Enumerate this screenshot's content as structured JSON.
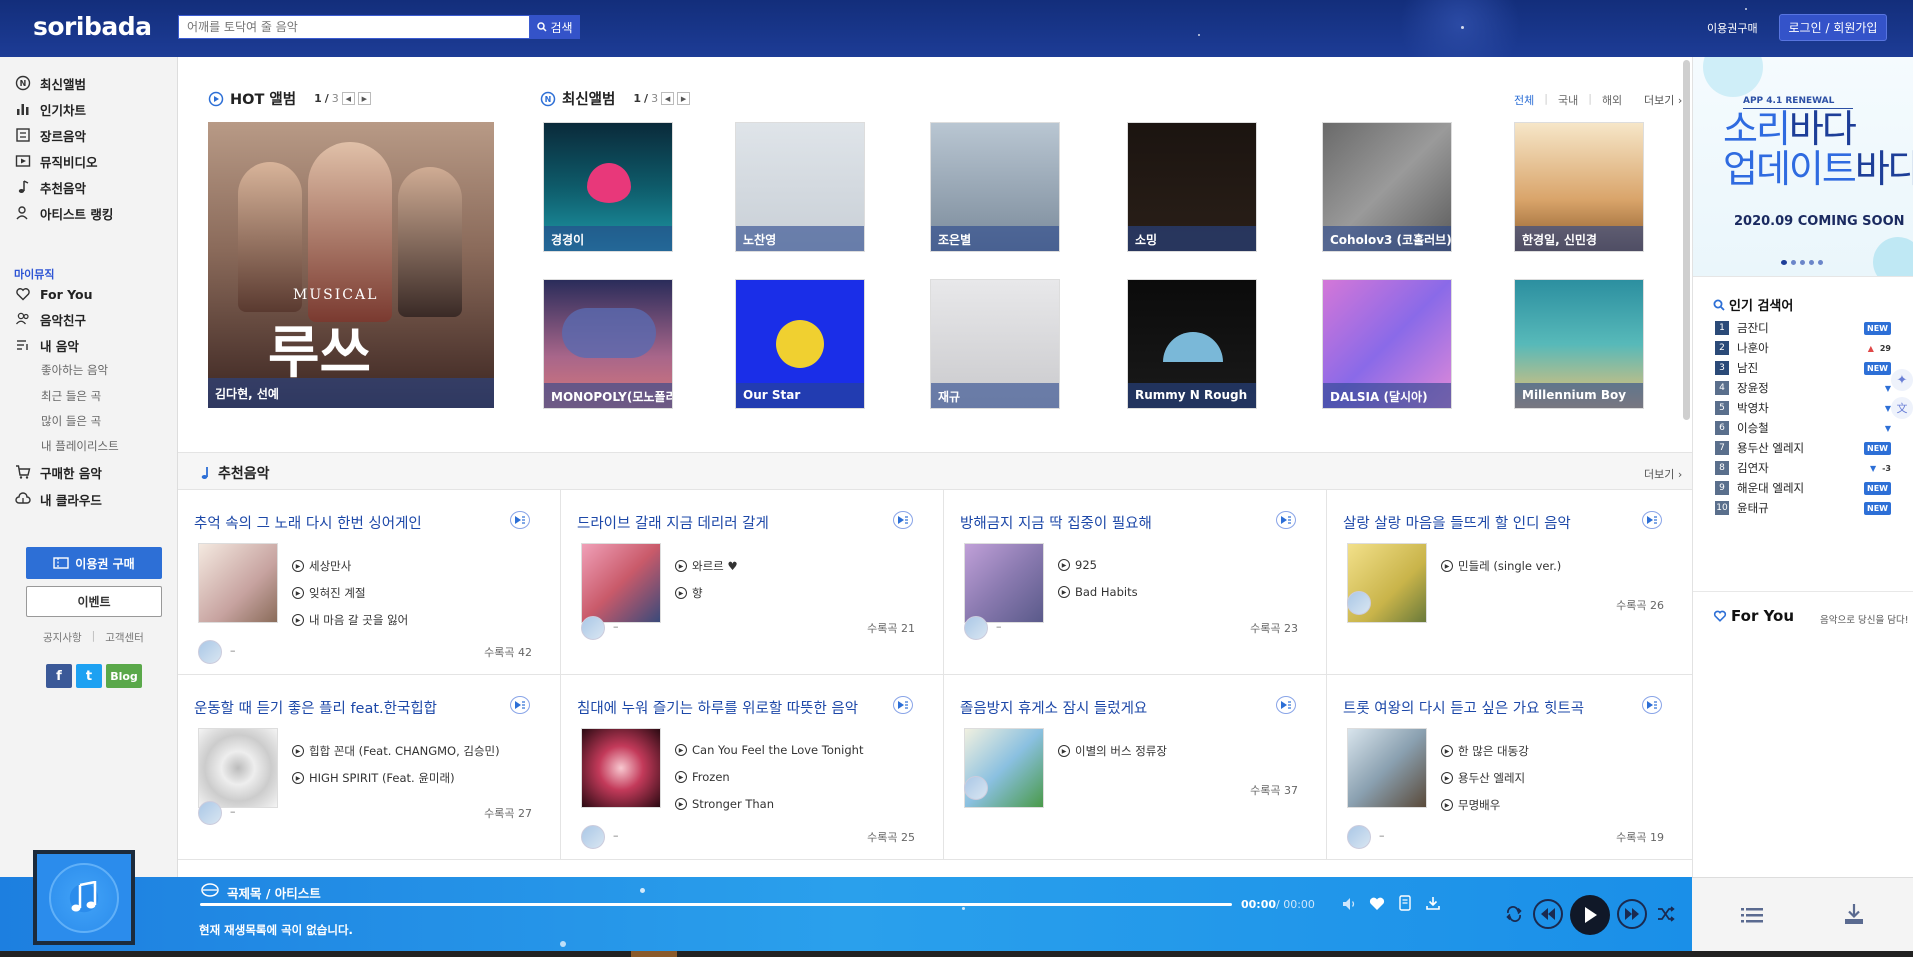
{
  "header": {
    "logo": "soribada",
    "search_placeholder": "어깨를 토닥여 줄 음악",
    "search_button": "검색",
    "voucher_link": "이용권구매",
    "login_button": "로그인 / 회원가입"
  },
  "sidebar": {
    "main_items": [
      {
        "label": "최신앨범",
        "icon": "new-album-icon"
      },
      {
        "label": "인기차트",
        "icon": "chart-icon"
      },
      {
        "label": "장르음악",
        "icon": "genre-icon"
      },
      {
        "label": "뮤직비디오",
        "icon": "video-icon"
      },
      {
        "label": "추천음악",
        "icon": "note-icon"
      },
      {
        "label": "아티스트 랭킹",
        "icon": "artist-icon"
      }
    ],
    "my_music_label": "마이뮤직",
    "my_items": [
      {
        "label": "For You",
        "icon": "heart-icon"
      },
      {
        "label": "음악친구",
        "icon": "friends-icon"
      },
      {
        "label": "내 음악",
        "icon": "playlist-icon"
      }
    ],
    "sub_items": [
      "좋아하는 음악",
      "최근 들은 곡",
      "많이 들은 곡",
      "내 플레이리스트"
    ],
    "extra_items": [
      {
        "label": "구매한 음악",
        "icon": "cart-icon"
      },
      {
        "label": "내 클라우드",
        "icon": "cloud-icon"
      }
    ],
    "buy_button": "이용권 구매",
    "event_button": "이벤트",
    "footer_links": [
      "공지사항",
      "고객센터"
    ],
    "social": [
      "f",
      "t",
      "Blog"
    ]
  },
  "hot": {
    "title": "HOT 앨범",
    "page_current": "1",
    "page_total": "3",
    "album_label": "김다현, 선예"
  },
  "latest": {
    "title": "최신앨범",
    "page_current": "1",
    "page_total": "3",
    "filters": [
      "전체",
      "국내",
      "해외"
    ],
    "more": "더보기",
    "albums": [
      {
        "label": "경경이",
        "bg": "linear-gradient(180deg,#0a2a3a,#0e5b6a 50%,#1e9aa8)"
      },
      {
        "label": "노찬영",
        "bg": "linear-gradient(180deg,#dfe4e9,#c8cfd6)"
      },
      {
        "label": "조은별",
        "bg": "linear-gradient(180deg,#b9c6d2,#7a8a9a)"
      },
      {
        "label": "소밍",
        "bg": "linear-gradient(180deg,#1b1410,#2a1f18)"
      },
      {
        "label": "Coholov3 (코홀러브)",
        "bg": "linear-gradient(135deg,#6a6a6a,#9a9a9a 50%,#5a5a5a)"
      },
      {
        "label": "한경일, 신민경",
        "bg": "linear-gradient(180deg,#f6e6c8,#d9a46a 60%,#8a5a2a)"
      },
      {
        "label": "MONOPOLY(모노폴리)",
        "bg": "linear-gradient(180deg,#2a2c5a,#a8668a 60%,#d8787a)"
      },
      {
        "label": "Our Star",
        "bg": "#1a2ee8"
      },
      {
        "label": "재규",
        "bg": "linear-gradient(180deg,#e8e8ea,#c9c9cc)"
      },
      {
        "label": "Rummy N Rough",
        "bg": "linear-gradient(180deg,#0b0b0b,#1a1a1a)"
      },
      {
        "label": "DALSIA (달시아)",
        "bg": "linear-gradient(135deg,#d477d8,#8a6ae8 50%,#e28ad8)"
      },
      {
        "label": "Millennium Boy",
        "bg": "linear-gradient(180deg,#2c8fa0,#57b9b9 50%,#f0c070)"
      }
    ]
  },
  "recommend": {
    "title": "추천음악",
    "more": "더보기",
    "cards": [
      {
        "title": "추억 속의 그 노래 다시 한번 싱어게인",
        "tracks": [
          "세상만사",
          "잊혀진 계절",
          "내 마음 갈 곳을 잃어"
        ],
        "count": "수록곡 42",
        "thumb": "linear-gradient(135deg,#f4e9e0,#c7a3a0 60%,#8a6c5a)"
      },
      {
        "title": "드라이브 갈래 지금 데리러 갈게",
        "tracks": [
          "와르르 ♥",
          "향"
        ],
        "count": "수록곡 21",
        "thumb": "linear-gradient(135deg,#f0a0b8,#c95a6a 50%,#3a4a7a)"
      },
      {
        "title": "방해금지 지금 딱 집중이 필요해",
        "tracks": [
          "925",
          "Bad Habits"
        ],
        "count": "수록곡 23",
        "thumb": "linear-gradient(135deg,#c0a0d8,#8a7ab0 50%,#5a5a8a)"
      },
      {
        "title": "살랑 살랑 마음을 들뜨게 할 인디 음악",
        "tracks": [
          "민들레 (single ver.)"
        ],
        "count": "수록곡 26",
        "thumb": "linear-gradient(135deg,#f2e08a,#c9b44a 60%,#6a7a3a)"
      },
      {
        "title": "운동할 때 듣기 좋은 플리 feat.한국힙합",
        "tracks": [
          "힙합 꼰대 (Feat. CHANGMO, 김승민)",
          "HIGH SPIRIT (Feat. 윤미래)"
        ],
        "count": "수록곡 27",
        "thumb": "radial-gradient(circle,#bbb 0,#eee 30%,#ccc 60%,#f4f4f4)"
      },
      {
        "title": "침대에 누워 즐기는 하루를 위로할 따뜻한 음악",
        "tracks": [
          "Can You Feel the Love Tonight",
          "Frozen",
          "Stronger Than"
        ],
        "count": "수록곡 25",
        "thumb": "radial-gradient(circle,#f8c8d0 0,#c33a5a 40%,#2a0a12)"
      },
      {
        "title": "졸음방지 휴게소 잠시 들렀게요",
        "tracks": [
          "이별의 버스 정류장"
        ],
        "count": "수록곡 37",
        "thumb": "linear-gradient(135deg,#f0f0e0,#8ac0e0 50%,#4a9a4a)"
      },
      {
        "title": "트롯 여왕의 다시 듣고 싶은 가요 힛트곡",
        "tracks": [
          "한 많은 대동강",
          "용두산 엘레지",
          "무명배우"
        ],
        "count": "수록곡 19",
        "thumb": "linear-gradient(135deg,#d8e4ec,#8aa0b0 50%,#5a4a3a)"
      }
    ]
  },
  "right": {
    "banner_sub": "APP 4.1 RENEWAL",
    "banner_line1_a": "소리",
    "banner_line1_b": "바다",
    "banner_line2_a": "업데이트",
    "banner_line2_b": "바다",
    "banner_date": "2020.09 COMING SOON",
    "popular_title": "인기 검색어",
    "keywords": [
      {
        "rank": "1",
        "word": "금잔디",
        "badge": "NEW",
        "type": "new"
      },
      {
        "rank": "2",
        "word": "나훈아",
        "badge": "▲ 29",
        "type": "up"
      },
      {
        "rank": "3",
        "word": "남진",
        "badge": "NEW",
        "type": "new"
      },
      {
        "rank": "4",
        "word": "장윤정",
        "badge": "▼",
        "type": "down"
      },
      {
        "rank": "5",
        "word": "박영차",
        "badge": "▼",
        "type": "down"
      },
      {
        "rank": "6",
        "word": "이승철",
        "badge": "▼",
        "type": "down"
      },
      {
        "rank": "7",
        "word": "용두산 엘레지",
        "badge": "NEW",
        "type": "new"
      },
      {
        "rank": "8",
        "word": "김연자",
        "badge": "▼ -3",
        "type": "down"
      },
      {
        "rank": "9",
        "word": "해운대 엘레지",
        "badge": "NEW",
        "type": "new"
      },
      {
        "rank": "10",
        "word": "윤태규",
        "badge": "NEW",
        "type": "new"
      }
    ],
    "foryou_title": "For You",
    "foryou_sub": "음악으로 당신을 담다!"
  },
  "player": {
    "track_title": "곡제목 / 아티스트",
    "status": "현재 재생목록에 곡이 없습니다.",
    "time_current": "00:00",
    "time_total": "/ 00:00"
  }
}
